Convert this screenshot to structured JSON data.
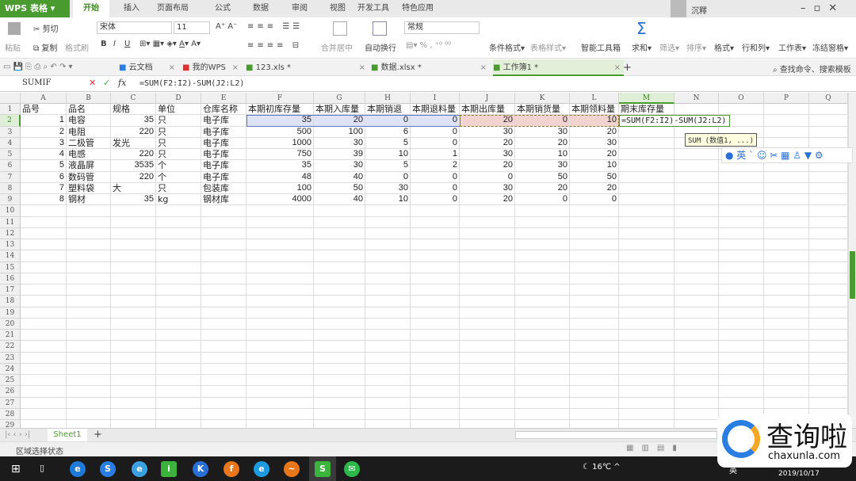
{
  "app": {
    "logo": "WPS 表格",
    "user": "沉釋",
    "menu_tabs": [
      "开始",
      "插入",
      "页面布局",
      "公式",
      "数据",
      "审阅",
      "视图",
      "开发工具",
      "特色应用"
    ],
    "active_tab": "开始"
  },
  "ribbon": {
    "paste": "粘贴",
    "cut": "剪切",
    "copy": "复制",
    "format_painter": "格式刷",
    "font": "宋体",
    "font_size": "11",
    "bold": "B",
    "italic": "I",
    "underline": "U",
    "merge": "合并居中",
    "wrap": "自动换行",
    "number_format": "常规",
    "cond_format": "条件格式",
    "table_style": "表格样式",
    "toolbox": "智能工具箱",
    "sum": "求和",
    "filter": "筛选",
    "sort": "排序",
    "format": "格式",
    "rowcol": "行和列",
    "sheet": "工作表",
    "freeze": "冻结窗格"
  },
  "doc_tabs": [
    {
      "label": "云文档"
    },
    {
      "label": "我的WPS"
    },
    {
      "label": "123.xls *"
    },
    {
      "label": "数据.xlsx *"
    },
    {
      "label": "工作簿1 *",
      "active": true
    }
  ],
  "search_placeholder": "查找命令、搜索模板",
  "formula_bar": {
    "name_box": "SUMIF",
    "fx": "fx",
    "formula": "=SUM(F2:I2)-SUM(J2:L2)"
  },
  "columns": [
    "A",
    "B",
    "C",
    "D",
    "E",
    "F",
    "G",
    "H",
    "I",
    "J",
    "K",
    "L",
    "M",
    "N",
    "O",
    "P",
    "Q"
  ],
  "rows": [
    [
      "品号",
      "品名",
      "规格",
      "单位",
      "仓库名称",
      "本期初库存量",
      "本期入库量",
      "本期销退",
      "本期退料量",
      "本期出库量",
      "本期销货量",
      "本期领料量",
      "期末库存量"
    ],
    [
      "1",
      "电容",
      "35",
      "只",
      "电子库",
      "35",
      "20",
      "0",
      "0",
      "20",
      "0",
      "10",
      "=SUM(F2:I2)-SUM(J2:L2)"
    ],
    [
      "2",
      "电阻",
      "220",
      "只",
      "电子库",
      "500",
      "100",
      "6",
      "0",
      "30",
      "30",
      "20",
      ""
    ],
    [
      "3",
      "二极管",
      "发光",
      "只",
      "电子库",
      "1000",
      "30",
      "5",
      "0",
      "20",
      "20",
      "30",
      ""
    ],
    [
      "4",
      "电感",
      "220",
      "只",
      "电子库",
      "750",
      "39",
      "10",
      "1",
      "30",
      "10",
      "20",
      ""
    ],
    [
      "5",
      "液晶屏",
      "3535",
      "个",
      "电子库",
      "35",
      "30",
      "5",
      "2",
      "20",
      "30",
      "10",
      ""
    ],
    [
      "6",
      "数码管",
      "220",
      "个",
      "电子库",
      "48",
      "40",
      "0",
      "0",
      "0",
      "50",
      "50",
      ""
    ],
    [
      "7",
      "塑料袋",
      "大",
      "只",
      "包装库",
      "100",
      "50",
      "30",
      "0",
      "30",
      "20",
      "20",
      ""
    ],
    [
      "8",
      "钢材",
      "35",
      "kg",
      "钢材库",
      "4000",
      "40",
      "10",
      "0",
      "20",
      "0",
      "0",
      ""
    ]
  ],
  "row_count": 29,
  "tooltip": "SUM (数值1, ...)",
  "ime": {
    "lang": "英"
  },
  "sheet_tabs": [
    "Sheet1"
  ],
  "status": "区域选择状态",
  "watermark": {
    "text": "查询啦",
    "url": "chaxunla.com"
  },
  "taskbar": {
    "temp": "16℃",
    "date": "2019/10/17",
    "ime": "英"
  },
  "colors": {
    "accent": "#4a9b2f",
    "sel_blue": "#dde3f5",
    "sel_red": "#f3d3cf"
  }
}
